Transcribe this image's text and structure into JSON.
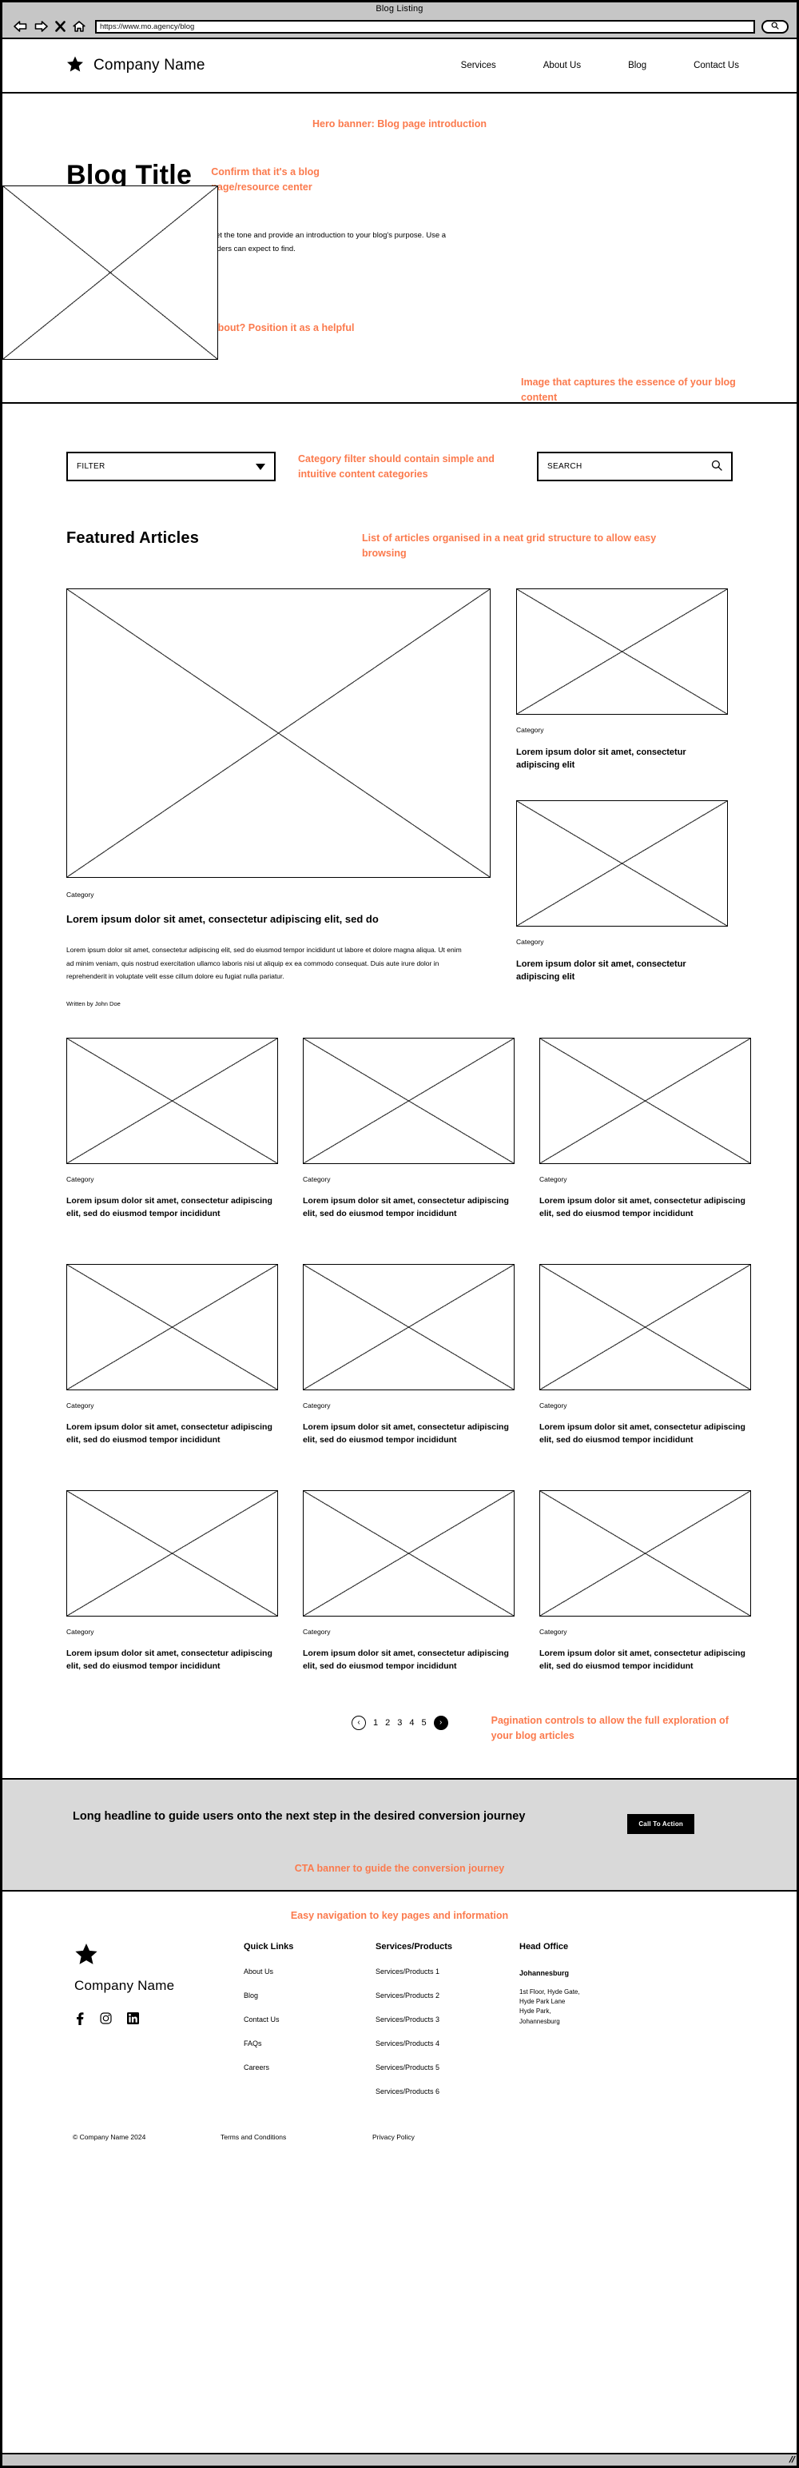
{
  "browser": {
    "tab_title": "Blog Listing",
    "url": "https://www.mo.agency/blog",
    "back_icon": "back-arrow-icon",
    "forward_icon": "forward-arrow-icon",
    "stop_icon": "close-x-icon",
    "home_icon": "home-icon",
    "go_icon": "search-icon"
  },
  "header": {
    "logo_icon": "star-icon",
    "brand": "Company Name",
    "nav": [
      {
        "label": "Services"
      },
      {
        "label": "About Us"
      },
      {
        "label": "Blog"
      },
      {
        "label": "Contact Us"
      }
    ]
  },
  "hero": {
    "annotation_top": "Hero banner: Blog page introduction",
    "title": "Blog Title",
    "annotation_title": "Confirm that it's a blog page/resource center",
    "paragraph": "The hero banner on your blog page should set the tone and provide an introduction to your blog's purpose. Use a headline and subheading to explain what readers can expect to find.",
    "annotation_bottom": "What is the blog page about? Position it as a helpful resource center.",
    "image_placeholder": "hero-image-placeholder",
    "image_caption": "Image that captures the essence of your blog content"
  },
  "articles": {
    "filter_label": "FILTER",
    "filter_annotation": "Category filter should contain simple and intuitive content categories",
    "search_placeholder": "SEARCH",
    "search_icon": "magnifier-icon",
    "section_title": "Featured Articles",
    "grid_annotation": "List of articles organised in a neat grid structure to allow easy browsing",
    "featured": {
      "category": "Category",
      "title": "Lorem ipsum dolor sit amet, consectetur adipiscing elit, sed do",
      "body": "Lorem ipsum dolor sit amet, consectetur adipiscing elit, sed do eiusmod tempor incididunt ut labore et dolore magna aliqua. Ut enim ad minim veniam, quis nostrud exercitation ullamco laboris nisi ut aliquip ex ea commodo consequat. Duis aute irure dolor in reprehenderit in voluptate velit esse cillum dolore eu fugiat nulla pariatur.",
      "author": "Written by John Doe"
    },
    "side_cards": [
      {
        "category": "Category",
        "title": "Lorem ipsum dolor sit amet, consectetur adipiscing elit"
      },
      {
        "category": "Category",
        "title": "Lorem ipsum dolor sit amet, consectetur adipiscing elit"
      }
    ],
    "grid_cards": [
      {
        "category": "Category",
        "title": "Lorem ipsum dolor sit amet, consectetur adipiscing elit, sed do eiusmod tempor incididunt"
      },
      {
        "category": "Category",
        "title": "Lorem ipsum dolor sit amet, consectetur adipiscing elit, sed do eiusmod tempor incididunt"
      },
      {
        "category": "Category",
        "title": "Lorem ipsum dolor sit amet, consectetur adipiscing elit, sed do eiusmod tempor incididunt"
      },
      {
        "category": "Category",
        "title": "Lorem ipsum dolor sit amet, consectetur adipiscing elit, sed do eiusmod tempor incididunt"
      },
      {
        "category": "Category",
        "title": "Lorem ipsum dolor sit amet, consectetur adipiscing elit, sed do eiusmod tempor incididunt"
      },
      {
        "category": "Category",
        "title": "Lorem ipsum dolor sit amet, consectetur adipiscing elit, sed do eiusmod tempor incididunt"
      },
      {
        "category": "Category",
        "title": "Lorem ipsum dolor sit amet, consectetur adipiscing elit, sed do eiusmod tempor incididunt"
      },
      {
        "category": "Category",
        "title": "Lorem ipsum dolor sit amet, consectetur adipiscing elit, sed do eiusmod tempor incididunt"
      },
      {
        "category": "Category",
        "title": "Lorem ipsum dolor sit amet, consectetur adipiscing elit, sed do eiusmod tempor incididunt"
      }
    ],
    "pagination": {
      "prev_icon": "chevron-left-icon",
      "next_icon": "chevron-right-icon",
      "pages": [
        "1",
        "2",
        "3",
        "4",
        "5"
      ],
      "annotation": "Pagination controls to allow the full exploration of your blog articles"
    }
  },
  "cta": {
    "headline": "Long headline to guide users onto the next step in the desired conversion journey",
    "button": "Call To Action",
    "annotation": "CTA banner to guide the conversion journey"
  },
  "footer": {
    "annotation": "Easy navigation to key pages and information",
    "logo_icon": "star-icon",
    "brand": "Company Name",
    "socials": [
      {
        "icon": "facebook-icon"
      },
      {
        "icon": "instagram-icon"
      },
      {
        "icon": "linkedin-icon"
      }
    ],
    "quick_links": {
      "heading": "Quick Links",
      "items": [
        "About Us",
        "Blog",
        "Contact Us",
        "FAQs",
        "Careers"
      ]
    },
    "services": {
      "heading": "Services/Products",
      "items": [
        "Services/Products 1",
        "Services/Products 2",
        "Services/Products 3",
        "Services/Products 4",
        "Services/Products 5",
        "Services/Products 6"
      ]
    },
    "head_office": {
      "heading": "Head Office",
      "city": "Johannesburg",
      "address": "1st Floor, Hyde Gate,\nHyde Park Lane\nHyde Park,\nJohannesburg"
    },
    "bottom": {
      "copyright": "© Company Name 2024",
      "terms": "Terms and Conditions",
      "privacy": "Privacy Policy"
    }
  },
  "colors": {
    "annotation": "#FB7A4D",
    "cta_background": "#d9d9d9",
    "chrome": "#c6c6c6"
  }
}
